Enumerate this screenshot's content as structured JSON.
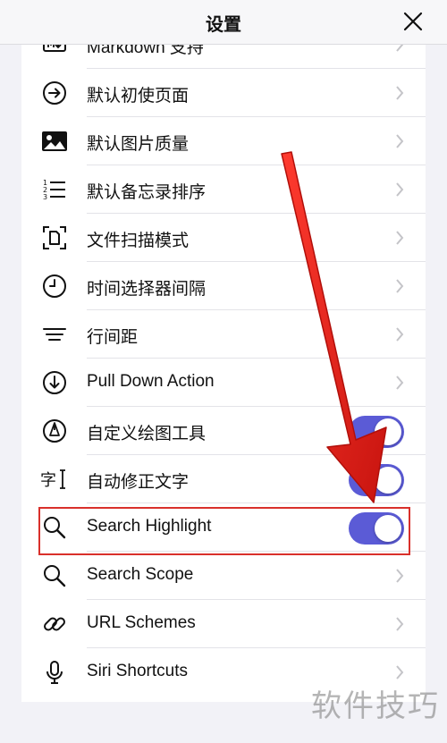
{
  "header": {
    "title": "设置",
    "close_icon": "close-icon"
  },
  "rows": [
    {
      "label": "Markdown 支持",
      "icon": "markdown-icon",
      "control": "chevron"
    },
    {
      "label": "默认初使页面",
      "icon": "arrow-circle-right-icon",
      "control": "chevron"
    },
    {
      "label": "默认图片质量",
      "icon": "image-icon",
      "control": "chevron"
    },
    {
      "label": "默认备忘录排序",
      "icon": "numbered-list-icon",
      "control": "chevron"
    },
    {
      "label": "文件扫描模式",
      "icon": "document-scan-icon",
      "control": "chevron"
    },
    {
      "label": "时间选择器间隔",
      "icon": "clock-icon",
      "control": "chevron"
    },
    {
      "label": "行间距",
      "icon": "line-spacing-icon",
      "control": "chevron"
    },
    {
      "label": "Pull Down Action",
      "icon": "arrow-circle-down-icon",
      "control": "chevron"
    },
    {
      "label": "自定义绘图工具",
      "icon": "pen-tip-icon",
      "control": "toggle",
      "on": true
    },
    {
      "label": "自动修正文字",
      "icon": "text-cursor-icon",
      "icon_text": "字",
      "control": "toggle",
      "on": true
    },
    {
      "label": "Search Highlight",
      "icon": "search-icon",
      "control": "toggle",
      "on": true
    },
    {
      "label": "Search Scope",
      "icon": "search-icon",
      "control": "chevron"
    },
    {
      "label": "URL Schemes",
      "icon": "link-icon",
      "control": "chevron"
    },
    {
      "label": "Siri Shortcuts",
      "icon": "microphone-icon",
      "control": "chevron"
    }
  ],
  "annotation": {
    "color": "#e5231b",
    "toggle_color": "#5b5bd6"
  },
  "watermark": "软件技巧"
}
